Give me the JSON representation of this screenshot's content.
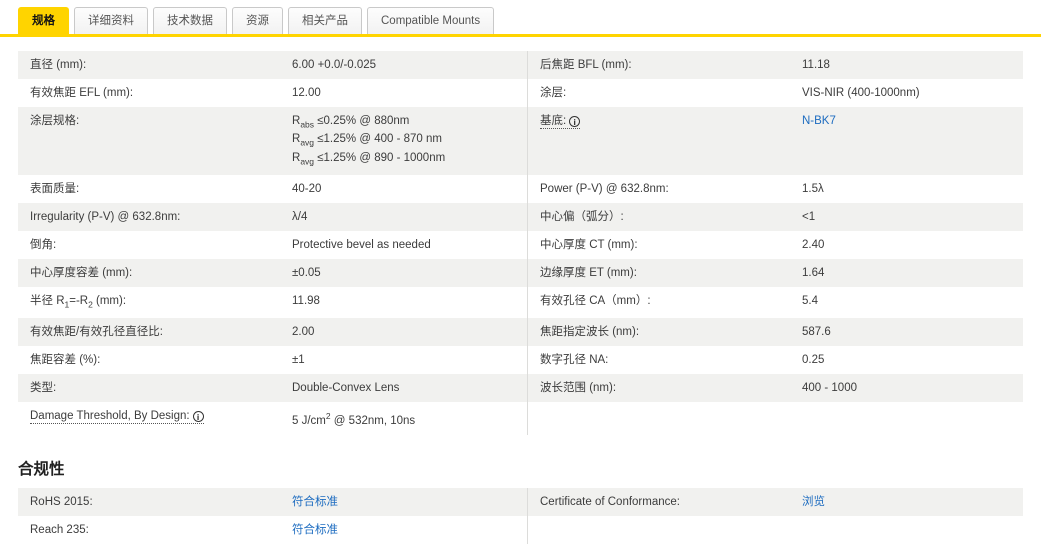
{
  "colors": {
    "accent_yellow": "#FFD400",
    "link_blue": "#1D6CC0",
    "row_gray": "#F1F1EF"
  },
  "icons": {
    "info_glyph": "i"
  },
  "tabs": {
    "items": [
      {
        "label": "规格",
        "active": true
      },
      {
        "label": "详细资料",
        "active": false
      },
      {
        "label": "技术数据",
        "active": false
      },
      {
        "label": "资源",
        "active": false
      },
      {
        "label": "相关产品",
        "active": false
      },
      {
        "label": "Compatible Mounts",
        "active": false
      }
    ]
  },
  "specs": {
    "rows": [
      {
        "l_label": "直径 (mm):",
        "l_value": "6.00 +0.0/-0.025",
        "r_label": "后焦距 BFL (mm):",
        "r_value": "11.18"
      },
      {
        "l_label": "有效焦距 EFL (mm):",
        "l_value": "12.00",
        "r_label": "涂层:",
        "r_value": "VIS-NIR (400-1000nm)"
      },
      {},
      {
        "l_label": "表面质量:",
        "l_value": "40-20",
        "r_label": "Power (P-V) @ 632.8nm:",
        "r_value": "1.5λ"
      },
      {
        "l_label": "Irregularity (P-V) @ 632.8nm:",
        "l_value": "λ/4",
        "r_label": "中心偏（弧分）:",
        "r_value": "<1"
      },
      {
        "l_label": "倒角:",
        "l_value": "Protective bevel as needed",
        "r_label": "中心厚度 CT (mm):",
        "r_value": "2.40"
      },
      {
        "l_label": "中心厚度容差 (mm):",
        "l_value": "±0.05",
        "r_label": "边缘厚度 ET (mm):",
        "r_value": "1.64"
      },
      {
        "l_value": "11.98",
        "r_label": "有效孔径 CA（mm）:",
        "r_value": "5.4"
      },
      {
        "l_label": "有效焦距/有效孔径直径比:",
        "l_value": "2.00",
        "r_label": "焦距指定波长 (nm):",
        "r_value": "587.6"
      },
      {
        "l_label": "焦距容差 (%):",
        "l_value": "±1",
        "r_label": "数字孔径 NA:",
        "r_value": "0.25"
      },
      {
        "l_label": "类型:",
        "l_value": "Double-Convex Lens",
        "r_label": "波长范围 (nm):",
        "r_value": "400 - 1000"
      },
      {}
    ],
    "coating": {
      "label": "涂层规格:",
      "lines": [
        {
          "base": "R",
          "sub": "abs",
          "rest": " ≤0.25% @ 880nm"
        },
        {
          "base": "R",
          "sub": "avg",
          "rest": " ≤1.25% @ 400 - 870 nm"
        },
        {
          "base": "R",
          "sub": "avg",
          "rest": " ≤1.25% @ 890 - 1000nm"
        }
      ]
    },
    "substrate": {
      "label": "基底:",
      "link": "N-BK7"
    },
    "radius_label": {
      "p1": "半径 R",
      "s1": "1",
      "p2": "=-R",
      "s2": "2",
      "p3": " (mm):"
    },
    "damage": {
      "label": "Damage Threshold, By Design:",
      "v1": "5 J/cm",
      "sup": "2",
      "v2": " @ 532nm, 10ns"
    }
  },
  "compliance": {
    "heading": "合规性",
    "rows": [
      {
        "l_label": "RoHS 2015:",
        "l_link": "符合标准",
        "r_label": "Certificate of Conformance:",
        "r_link": "浏览"
      },
      {
        "l_label": "Reach 235:",
        "l_link": "符合标准"
      }
    ]
  }
}
